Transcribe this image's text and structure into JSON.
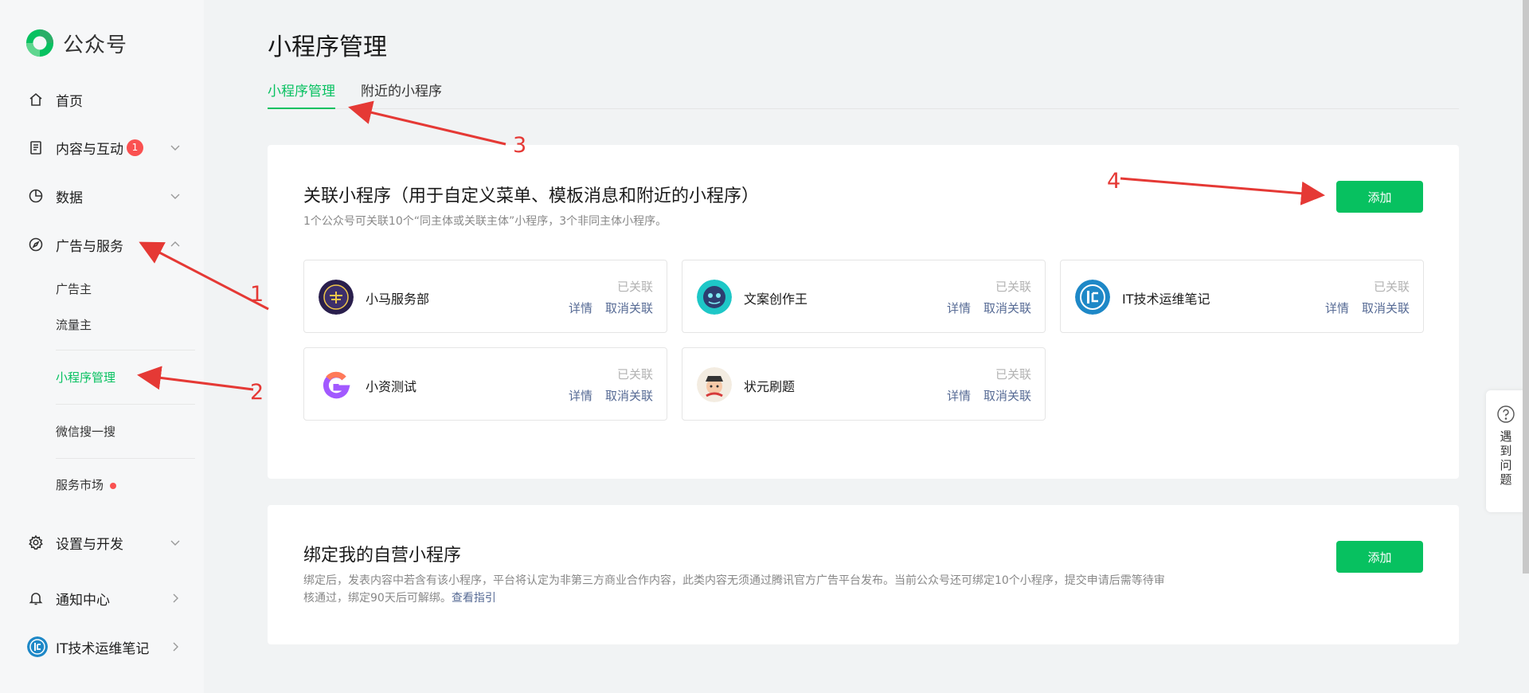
{
  "sidebar": {
    "logo_text": "公众号",
    "items": [
      {
        "label": "首页",
        "icon": "home-icon"
      },
      {
        "label": "内容与互动",
        "icon": "document-icon",
        "badge": "1"
      },
      {
        "label": "数据",
        "icon": "chart-pie-icon"
      },
      {
        "label": "广告与服务",
        "icon": "compass-icon"
      },
      {
        "label": "设置与开发",
        "icon": "gear-icon"
      },
      {
        "label": "通知中心",
        "icon": "bell-icon"
      },
      {
        "label": "IT技术运维笔记",
        "icon": "account-avatar"
      }
    ],
    "sub_items": [
      {
        "label": "广告主"
      },
      {
        "label": "流量主"
      },
      {
        "label": "小程序管理"
      },
      {
        "label": "微信搜一搜"
      },
      {
        "label": "服务市场"
      }
    ]
  },
  "main": {
    "title": "小程序管理",
    "tabs": [
      {
        "label": "小程序管理"
      },
      {
        "label": "附近的小程序"
      }
    ],
    "linked": {
      "title": "关联小程序（用于自定义菜单、模板消息和附近的小程序）",
      "desc": "1个公众号可关联10个“同主体或关联主体”小程序，3个非同主体小程序。",
      "add_label": "添加",
      "items": [
        {
          "name": "小马服务部",
          "status": "已关联",
          "detail": "详情",
          "unlink": "取消关联"
        },
        {
          "name": "文案创作王",
          "status": "已关联",
          "detail": "详情",
          "unlink": "取消关联"
        },
        {
          "name": "IT技术运维笔记",
          "status": "已关联",
          "detail": "详情",
          "unlink": "取消关联"
        },
        {
          "name": "小资测试",
          "status": "已关联",
          "detail": "详情",
          "unlink": "取消关联"
        },
        {
          "name": "状元刷题",
          "status": "已关联",
          "detail": "详情",
          "unlink": "取消关联"
        }
      ]
    },
    "bound": {
      "title": "绑定我的自营小程序",
      "desc_line1": "绑定后，发表内容中若含有该小程序，平台将认定为非第三方商业合作内容，此类内容无须通过腾讯官方广告平台发布。当前公众号还可绑定10个小程序，提交申请后需等待审",
      "desc_line2": "核通过，绑定90天后可解绑。",
      "guide_link": "查看指引",
      "add_label": "添加"
    }
  },
  "help": {
    "label": "遇到问题"
  },
  "annotations": [
    "1",
    "2",
    "3",
    "4"
  ],
  "colors": {
    "accent": "#07c160",
    "link": "#576b95",
    "badge": "#fa5151",
    "annotation": "#e53935"
  }
}
